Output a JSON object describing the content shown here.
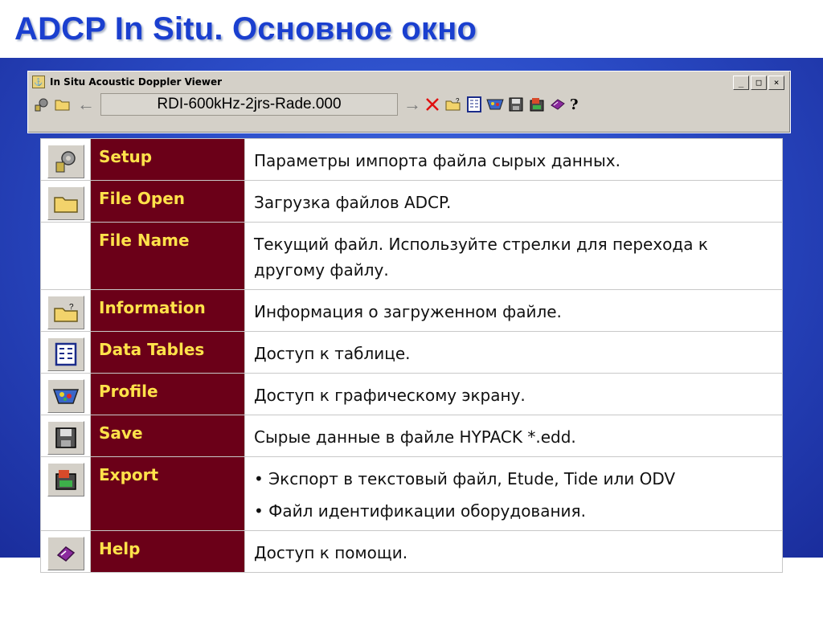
{
  "slide_title": "ADCP In Situ. Основное окно",
  "window": {
    "title": "In Situ Acoustic Doppler Viewer",
    "buttons": [
      "_",
      "□",
      "×"
    ],
    "file_name": "RDI-600kHz-2jrs-Rade.000",
    "help_label": "?"
  },
  "rows": [
    {
      "name": "Setup",
      "icon": "setup-icon",
      "desc": "Параметры импорта файла сырых данных."
    },
    {
      "name": "File Open",
      "icon": "folder-open-icon",
      "desc": "Загрузка  файлов ADCP."
    },
    {
      "name": "File Name",
      "icon": "",
      "desc": "Текущий файл. Используйте стрелки для перехода к другому файлу."
    },
    {
      "name": "Information",
      "icon": "information-folder-icon",
      "desc": "Информация о загруженном файле."
    },
    {
      "name": "Data Tables",
      "icon": "data-tables-icon",
      "desc": "Доступ к таблице."
    },
    {
      "name": "Profile",
      "icon": "profile-icon",
      "desc": "Доступ к графическому экрану."
    },
    {
      "name": "Save",
      "icon": "save-icon",
      "desc": "Сырые данные в файле HYPACK *.edd."
    },
    {
      "name": "Export",
      "icon": "export-icon",
      "desc_bullets": [
        "Экспорт в текстовый файл, Etude, Tide или ODV",
        "Файл идентификации оборудования."
      ]
    },
    {
      "name": "Help",
      "icon": "help-book-icon",
      "desc": "Доступ к помощи."
    }
  ],
  "colors": {
    "title": "#1a3fcf",
    "name_bg": "#6b0018",
    "name_text": "#ffe24a"
  }
}
